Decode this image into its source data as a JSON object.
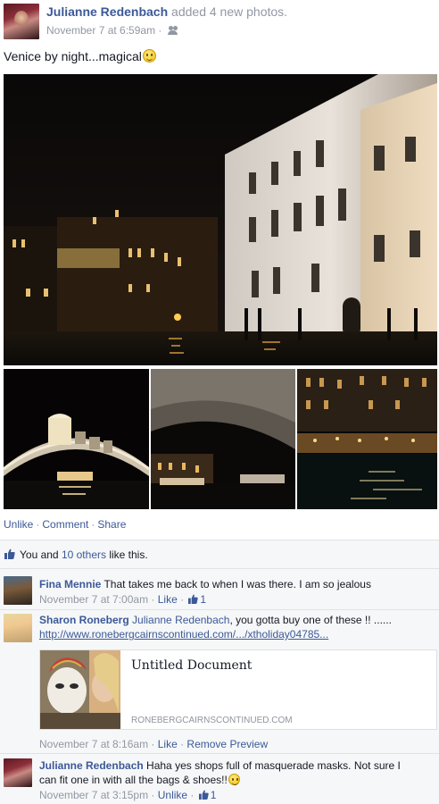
{
  "post": {
    "author": "Julianne Redenbach",
    "action": "added 4 new photos.",
    "timestamp": "November 7 at 6:59am",
    "separator": "·",
    "audience_icon": "friends-icon",
    "status": "Venice by night...magical"
  },
  "actions": {
    "unlike": "Unlike",
    "comment": "Comment",
    "share": "Share",
    "separator": "·"
  },
  "likes": {
    "prefix": "You and ",
    "others": "10 others",
    "suffix": " like this."
  },
  "comments": [
    {
      "author": "Fina Mennie",
      "text": "That takes me back to when I was there. I am so jealous",
      "timestamp": "November 7 at 7:00am",
      "like_label": "Like",
      "like_count": "1"
    },
    {
      "author": "Sharon Roneberg",
      "mention": "Julianne Redenbach",
      "text": ", you gotta buy one of these !! ......",
      "link": "http://www.ronebergcairnscontinued.com/.../xtholiday04785...",
      "preview_title": "Untitled Document",
      "preview_domain": "RONEBERGCAIRNSCONTINUED.COM",
      "timestamp": "November 7 at 8:16am",
      "like_label": "Like",
      "remove_label": "Remove Preview"
    },
    {
      "author": "Julianne Redenbach",
      "text": "Haha yes shops full of masquerade masks. Not sure I can fit one in with all the bags & shoes!!",
      "timestamp": "November 7 at 3:15pm",
      "like_label": "Unlike",
      "like_count": "1"
    }
  ],
  "colors": {
    "link": "#3b5998",
    "meta": "#9197a3",
    "background": "#f6f7f8"
  }
}
